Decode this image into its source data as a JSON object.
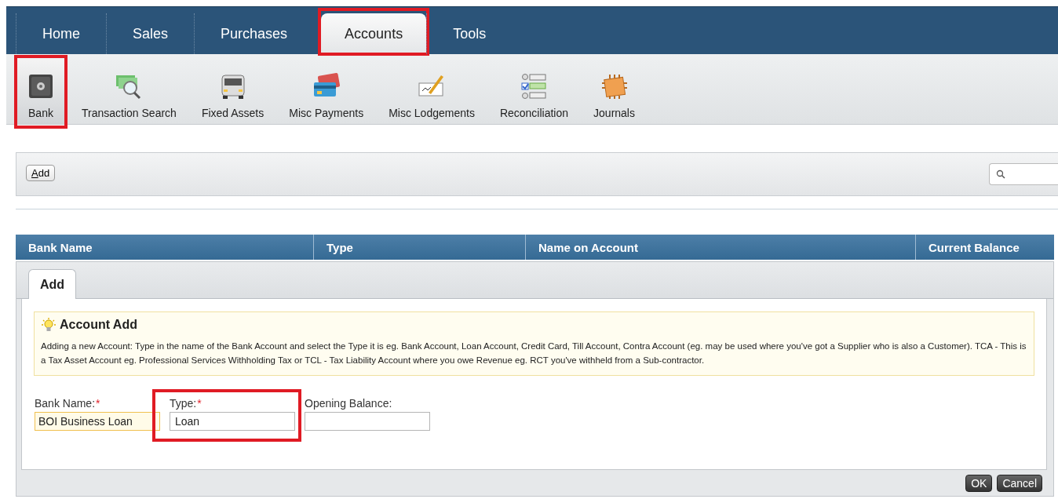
{
  "nav_tabs": [
    {
      "label": "Home",
      "selected": false,
      "highlighted": false
    },
    {
      "label": "Sales",
      "selected": false,
      "highlighted": false
    },
    {
      "label": "Purchases",
      "selected": false,
      "highlighted": false
    },
    {
      "label": "Accounts",
      "selected": true,
      "highlighted": true
    },
    {
      "label": "Tools",
      "selected": false,
      "highlighted": false
    }
  ],
  "toolbar": [
    {
      "label": "Bank",
      "kind": "safe",
      "selected": true,
      "highlighted": true
    },
    {
      "label": "Transaction Search",
      "kind": "search",
      "selected": false,
      "highlighted": false
    },
    {
      "label": "Fixed Assets",
      "kind": "assets",
      "selected": false,
      "highlighted": false
    },
    {
      "label": "Misc Payments",
      "kind": "payments",
      "selected": false,
      "highlighted": false
    },
    {
      "label": "Misc Lodgements",
      "kind": "lodgements",
      "selected": false,
      "highlighted": false
    },
    {
      "label": "Reconciliation",
      "kind": "reconciliation",
      "selected": false,
      "highlighted": false
    },
    {
      "label": "Journals",
      "kind": "journals",
      "selected": false,
      "highlighted": false
    }
  ],
  "action_bar": {
    "add_button": "Add"
  },
  "table": {
    "columns": [
      "Bank Name",
      "Type",
      "Name on Account",
      "Current Balance"
    ]
  },
  "form_panel": {
    "tab": {
      "label": "Add",
      "selected": true
    },
    "hint": {
      "title": "Account Add",
      "text": "Adding a new Account: Type in the name of the Bank Account and select the Type it is eg. Bank Account, Loan Account, Credit Card, Till Account, Contra Account (eg. may be used where you've got a Supplier who is also a Customer). TCA - This is a Tax Asset Account eg. Professional Services Withholding Tax or TCL - Tax Liability Account where you owe Revenue eg. RCT you've withheld from a Sub-contractor."
    },
    "fields": [
      {
        "label": "Bank Name:",
        "required_mark": "*",
        "value": "BOI Business Loan",
        "focused": true,
        "highlighted": false
      },
      {
        "label": "Type:",
        "required_mark": "*",
        "value": "Loan",
        "focused": false,
        "highlighted": true
      },
      {
        "label": "Opening Balance:",
        "focused": false,
        "highlighted": false
      }
    ],
    "buttons": [
      "OK",
      "Cancel"
    ]
  }
}
